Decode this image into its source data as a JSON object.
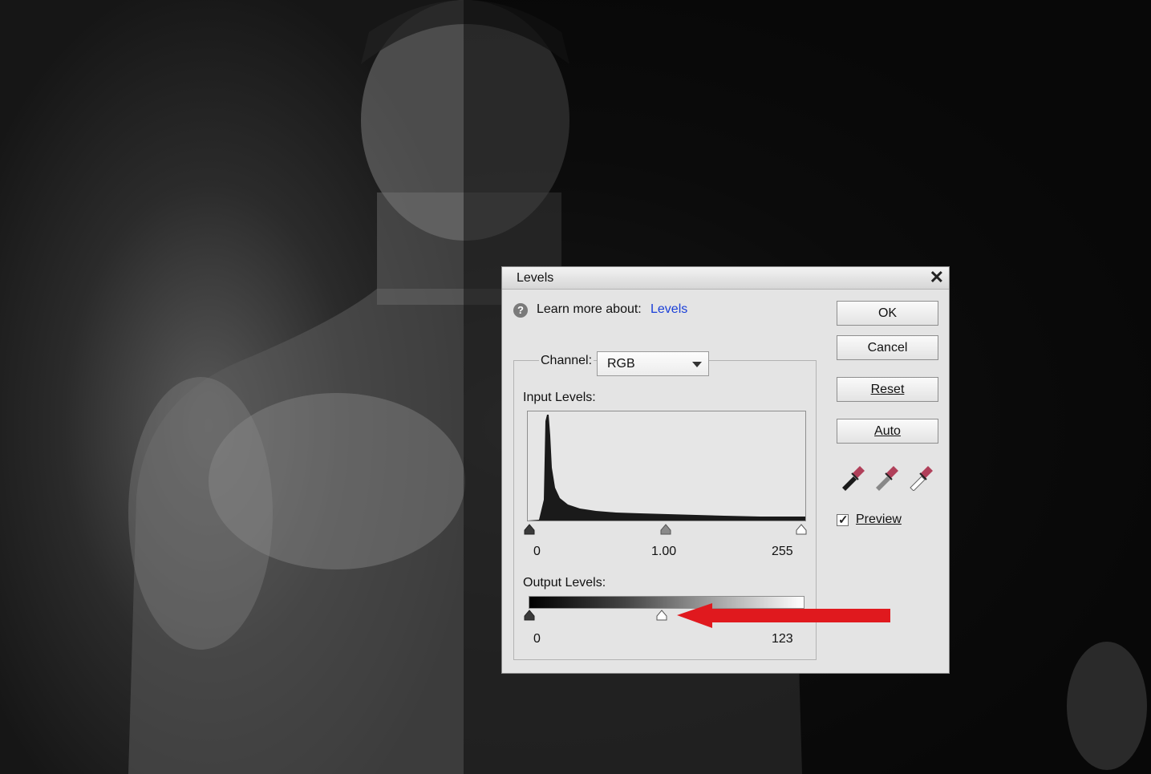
{
  "dialog": {
    "title": "Levels",
    "close_glyph": "✕",
    "help_text": "Learn more about:",
    "help_link": "Levels",
    "channel_label": "Channel:",
    "channel_value": "RGB",
    "input_levels_label": "Input Levels:",
    "output_levels_label": "Output Levels:",
    "input_values": {
      "black": "0",
      "gamma": "1.00",
      "white": "255"
    },
    "output_values": {
      "black": "0",
      "white": "123"
    },
    "buttons": {
      "ok": "OK",
      "cancel": "Cancel",
      "reset": "Reset",
      "auto": "Auto"
    },
    "preview_label": "Preview",
    "preview_checked": true,
    "eyedroppers": [
      "black-point-eyedropper-icon",
      "gray-point-eyedropper-icon",
      "white-point-eyedropper-icon"
    ]
  },
  "colors": {
    "annotation_arrow": "#e0191e",
    "help_link": "#1a3fd8"
  }
}
